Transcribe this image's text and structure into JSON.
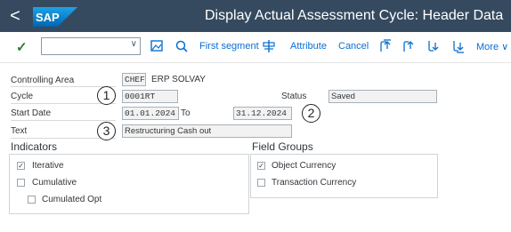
{
  "header": {
    "back_glyph": "<",
    "logo_text": "SAP",
    "title": "Display Actual Assessment Cycle: Header Data"
  },
  "toolbar": {
    "check_glyph": "✓",
    "command_value": "",
    "first_segment": "First segment",
    "attribute": "Attribute",
    "cancel": "Cancel",
    "more": "More ∨"
  },
  "form": {
    "controlling_area_label": "Controlling Area",
    "controlling_area_value": "CHEF",
    "controlling_area_desc": "ERP SOLVAY",
    "cycle_label": "Cycle",
    "cycle_value": "0001RT",
    "status_label": "Status",
    "status_value": "Saved",
    "start_date_label": "Start Date",
    "start_date_value": "01.01.2024",
    "to_label": "To",
    "to_value": "31.12.2024",
    "text_label": "Text",
    "text_value": "Restructuring Cash out"
  },
  "callouts": [
    "1",
    "2",
    "3"
  ],
  "indicators": {
    "title": "Indicators",
    "iterative": "Iterative",
    "iterative_checked": true,
    "cumulative": "Cumulative",
    "cumulative_checked": false,
    "cumulated_opt": "Cumulated Opt",
    "cumulated_opt_checked": false
  },
  "field_groups": {
    "title": "Field Groups",
    "object_currency": "Object Currency",
    "object_currency_checked": true,
    "transaction_currency": "Transaction Currency",
    "transaction_currency_checked": false
  },
  "colors": {
    "shell": "#354a5f",
    "accent": "#0a6ed1",
    "check": "#2b7d2b"
  },
  "icons": [
    "back-icon",
    "sap-logo",
    "check-icon",
    "dropdown-chevron-icon",
    "image-icon",
    "search-icon",
    "attribute-icon",
    "first-page-icon",
    "previous-page-icon",
    "next-page-icon",
    "last-page-icon"
  ]
}
